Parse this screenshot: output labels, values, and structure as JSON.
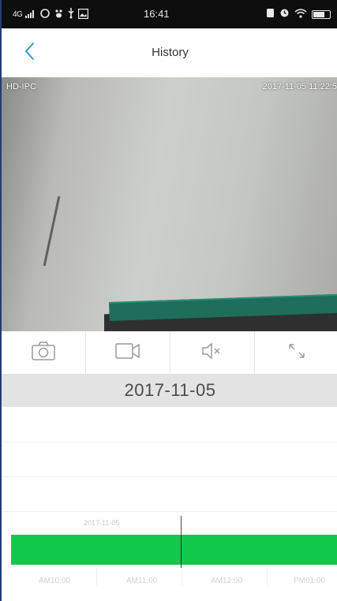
{
  "status_bar": {
    "network": "4G",
    "time": "16:41"
  },
  "header": {
    "title": "History"
  },
  "video": {
    "device_label": "HD-IPC",
    "timestamp": "2017-11-05  11:22:5"
  },
  "controls": {
    "items": [
      {
        "icon": "camera-icon",
        "action": "snapshot"
      },
      {
        "icon": "video-record-icon",
        "action": "record"
      },
      {
        "icon": "speaker-mute-icon",
        "action": "mute"
      },
      {
        "icon": "fullscreen-icon",
        "action": "fullscreen"
      }
    ]
  },
  "date_band": {
    "date": "2017-11-05"
  },
  "timeline": {
    "date_label": "2017-11-05",
    "recording_color": "#12c84b",
    "time_labels": [
      "AM10:00",
      "AM11:00",
      "AM12:00",
      "PM01:00"
    ]
  },
  "colors": {
    "accent": "#2b9be0",
    "recording": "#12c84b"
  }
}
